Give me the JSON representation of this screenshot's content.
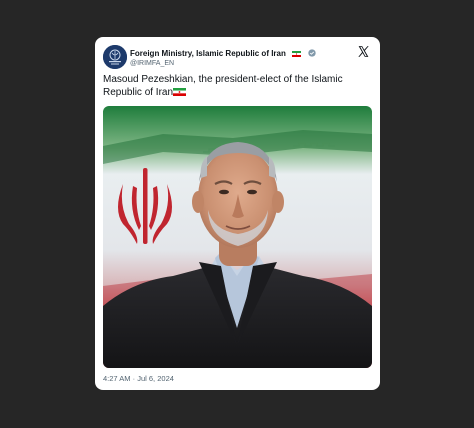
{
  "tweet": {
    "author": {
      "display_name": "Foreign Ministry, Islamic Republic of Iran",
      "handle": "@IRIMFA_EN",
      "verified_badge": "verified-gray-icon",
      "flag": "iran-flag-icon"
    },
    "platform_logo": "x-logo-icon",
    "text": "Masoud Pezeshkian, the president-elect of the Islamic Republic of Iran",
    "text_trailing_flag": "iran-flag-icon",
    "media": {
      "kind": "photo",
      "subject": "portrait-in-front-of-flag"
    },
    "time": "4:27 AM",
    "separator": "·",
    "date": "Jul 6, 2024"
  },
  "colors": {
    "page_background": "#262626",
    "card_background": "#ffffff",
    "text_primary": "#0f1419",
    "text_secondary": "#536471",
    "flag_green": "#239f40",
    "flag_white": "#ffffff",
    "flag_red": "#da0000"
  }
}
